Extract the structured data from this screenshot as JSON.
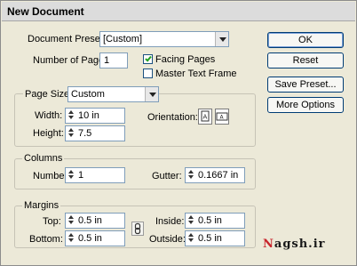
{
  "window": {
    "title": "New Document"
  },
  "document_preset": {
    "label": "Document Preset:",
    "value": "[Custom]"
  },
  "number_of_pages": {
    "label": "Number of Pages:",
    "value": "1"
  },
  "facing_pages": {
    "label": "Facing Pages",
    "checked": true
  },
  "master_text_frame": {
    "label": "Master Text Frame",
    "checked": false
  },
  "page_size": {
    "label": "Page Size:",
    "value": "Custom",
    "width_label": "Width:",
    "width_value": "10 in",
    "height_label": "Height:",
    "height_value": "7.5",
    "orientation_label": "Orientation:",
    "orientation_icons": [
      "portrait-orientation-icon",
      "landscape-orientation-icon"
    ]
  },
  "columns": {
    "title": "Columns",
    "number_label": "Number:",
    "number_value": "1",
    "gutter_label": "Gutter:",
    "gutter_value": "0.1667 in"
  },
  "margins": {
    "title": "Margins",
    "top_label": "Top:",
    "top_value": "0.5 in",
    "bottom_label": "Bottom:",
    "bottom_value": "0.5 in",
    "inside_label": "Inside:",
    "inside_value": "0.5 in",
    "outside_label": "Outside:",
    "outside_value": "0.5 in",
    "link_icon": "chain-link-icon"
  },
  "buttons": {
    "ok": "OK",
    "reset": "Reset",
    "save_preset": "Save Preset...",
    "more_options": "More Options"
  },
  "watermark": {
    "first": "N",
    "rest": "agsh.ir"
  },
  "colors": {
    "accent": "#21a121",
    "watermark_red": "#c8242b",
    "dialog_bg": "#ece9d8"
  }
}
